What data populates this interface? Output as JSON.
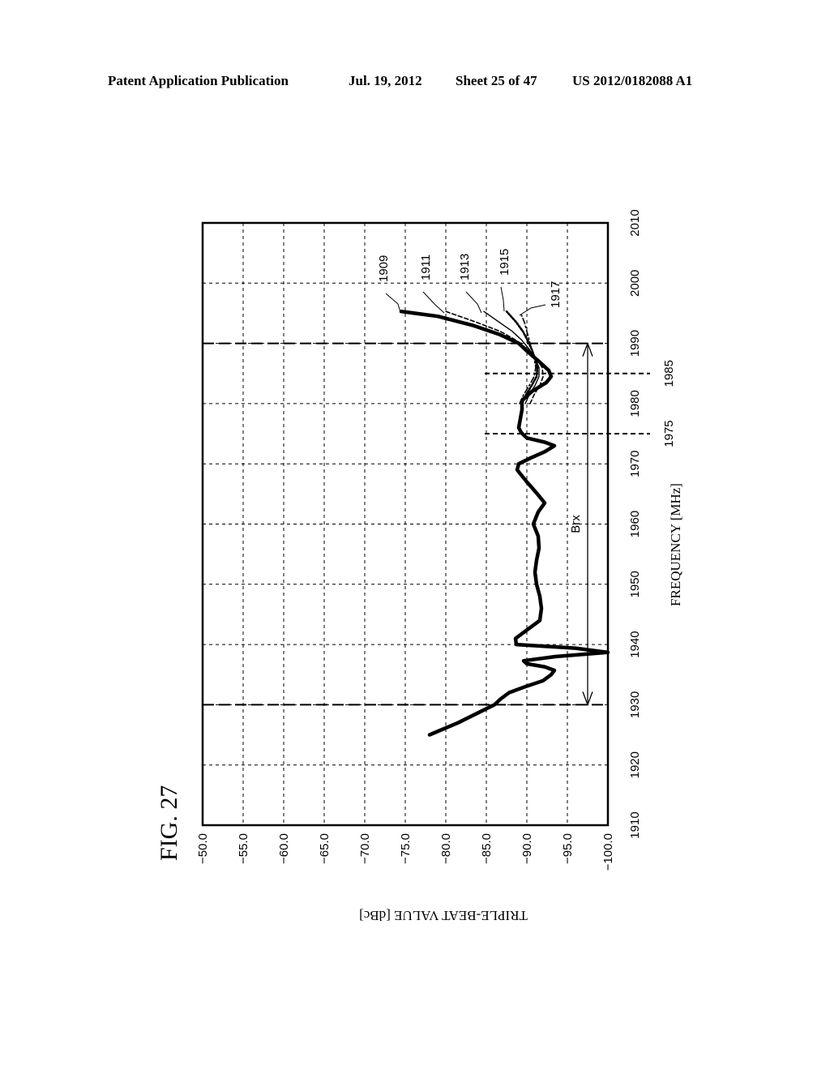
{
  "header": {
    "left": "Patent Application Publication",
    "date": "Jul. 19, 2012",
    "sheet": "Sheet 25 of 47",
    "publication": "US 2012/0182088 A1"
  },
  "figure_label": "FIG. 27",
  "chart_data": {
    "type": "line",
    "title": "FIG. 27",
    "orientation": "rotated 90 degrees counter-clockwise",
    "xlabel": "FREQUENCY [MHz]",
    "ylabel": "TRIPLE-BEAT VALUE [dBc]",
    "xlim": [
      1910,
      2010
    ],
    "ylim": [
      -100,
      -50
    ],
    "xticks": [
      1910,
      1920,
      1930,
      1940,
      1950,
      1960,
      1970,
      1980,
      1990,
      2000,
      2010
    ],
    "xtick_labels": [
      "1910",
      "1920",
      "1930",
      "1940",
      "1950",
      "1960",
      "1970",
      "1980",
      "1990",
      "2000",
      "2010"
    ],
    "yticks": [
      -50,
      -55,
      -60,
      -65,
      -70,
      -75,
      -80,
      -85,
      -90,
      -95,
      -100
    ],
    "ytick_labels": [
      "-50.0",
      "-55.0",
      "-60.0",
      "-65.0",
      "-70.0",
      "-75.0",
      "-80.0",
      "-85.0",
      "-90.0",
      "-95.0",
      "-100.0"
    ],
    "grid": true,
    "band_markers": [
      {
        "freq": 1930,
        "style": "long-dash"
      },
      {
        "freq": 1990,
        "style": "long-dash"
      },
      {
        "freq": 1975,
        "style": "short-dash",
        "label": "1975"
      },
      {
        "freq": 1985,
        "style": "short-dash",
        "label": "1985"
      }
    ],
    "band_arrow": {
      "from": 1930,
      "to": 1990,
      "value": -97.5,
      "label": "Brx"
    },
    "series": [
      {
        "name": "1909",
        "style": "thick-solid",
        "x": [
          1925,
          1927,
          1929,
          1930,
          1931,
          1932,
          1933,
          1934,
          1935,
          1935.7,
          1936.3,
          1936.8,
          1937.3,
          1938,
          1938.7,
          1939.4,
          1940,
          1941,
          1942,
          1944,
          1946,
          1948,
          1950,
          1952,
          1954,
          1956,
          1958,
          1960,
          1962,
          1963.5,
          1965,
          1967,
          1969,
          1970,
          1971,
          1972,
          1973,
          1973.6,
          1974.3,
          1975.2,
          1976,
          1977.5,
          1979,
          1980.5,
          1982,
          1983.5,
          1984.5,
          1985.5,
          1987,
          1988.5,
          1990,
          1991.5,
          1993,
          1994.5,
          1995.3
        ],
        "y": [
          -78.0,
          -81.5,
          -84.5,
          -86.0,
          -86.8,
          -87.8,
          -89.8,
          -92.0,
          -93.0,
          -93.4,
          -92.2,
          -90.0,
          -89.6,
          -93.5,
          -100.0,
          -96.0,
          -88.7,
          -88.6,
          -89.6,
          -91.6,
          -91.8,
          -91.6,
          -91.2,
          -91.0,
          -91.2,
          -91.5,
          -91.4,
          -90.8,
          -91.4,
          -92.2,
          -91.3,
          -90.0,
          -88.8,
          -89.0,
          -90.5,
          -92.2,
          -93.4,
          -92.2,
          -90.0,
          -89.3,
          -89.0,
          -89.2,
          -89.4,
          -89.4,
          -90.6,
          -92.4,
          -93.0,
          -92.7,
          -91.5,
          -90.2,
          -89.0,
          -86.6,
          -83.3,
          -79.0,
          -74.5
        ]
      },
      {
        "name": "1911",
        "style": "dashed",
        "x": [
          1980,
          1981.5,
          1983,
          1984.5,
          1986,
          1987.5,
          1989,
          1990.5,
          1992,
          1993.5,
          1995.3
        ],
        "y": [
          -90.4,
          -90.9,
          -91.6,
          -92.0,
          -91.9,
          -91.1,
          -90.1,
          -88.7,
          -86.7,
          -83.8,
          -80.0
        ]
      },
      {
        "name": "1913",
        "style": "thin-solid",
        "x": [
          1980,
          1981.5,
          1983,
          1984.5,
          1986,
          1987.5,
          1989,
          1990.5,
          1992,
          1993.5,
          1995.3
        ],
        "y": [
          -89.8,
          -90.3,
          -91.0,
          -91.5,
          -91.5,
          -91.0,
          -90.3,
          -89.4,
          -88.2,
          -86.6,
          -84.7
        ]
      },
      {
        "name": "1915",
        "style": "dotted-bold",
        "x": [
          1980,
          1981.5,
          1983,
          1984.5,
          1986,
          1987.5,
          1989,
          1990.5,
          1992,
          1993.5,
          1995.3
        ],
        "y": [
          -89.4,
          -89.9,
          -90.6,
          -91.2,
          -91.3,
          -91.0,
          -90.6,
          -90.1,
          -89.5,
          -88.7,
          -87.5
        ]
      },
      {
        "name": "1917",
        "style": "dash-dot",
        "x": [
          1980,
          1981.5,
          1983,
          1984.5,
          1986,
          1987.5,
          1989,
          1990.5,
          1992,
          1993.5,
          1994.8
        ],
        "y": [
          -89.1,
          -89.6,
          -90.3,
          -90.9,
          -91.1,
          -90.9,
          -90.6,
          -90.3,
          -90.0,
          -89.7,
          -89.3
        ]
      }
    ],
    "series_labels": [
      "1909",
      "1911",
      "1913",
      "1915",
      "1917"
    ]
  }
}
